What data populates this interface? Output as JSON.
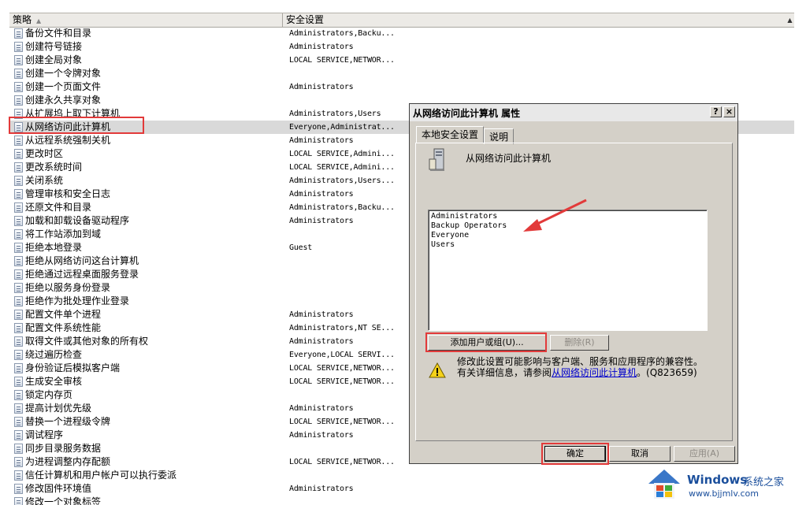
{
  "list": {
    "col_policy": "策略",
    "col_setting": "安全设置",
    "rows": [
      {
        "name": "备份文件和目录",
        "value": "Administrators,Backu..."
      },
      {
        "name": "创建符号链接",
        "value": "Administrators"
      },
      {
        "name": "创建全局对象",
        "value": "LOCAL SERVICE,NETWOR..."
      },
      {
        "name": "创建一个令牌对象",
        "value": ""
      },
      {
        "name": "创建一个页面文件",
        "value": "Administrators"
      },
      {
        "name": "创建永久共享对象",
        "value": ""
      },
      {
        "name": "从扩展坞上取下计算机",
        "value": "Administrators,Users"
      },
      {
        "name": "从网络访问此计算机",
        "value": "Everyone,Administrat..."
      },
      {
        "name": "从远程系统强制关机",
        "value": "Administrators"
      },
      {
        "name": "更改时区",
        "value": "LOCAL SERVICE,Admini..."
      },
      {
        "name": "更改系统时间",
        "value": "LOCAL SERVICE,Admini..."
      },
      {
        "name": "关闭系统",
        "value": "Administrators,Users..."
      },
      {
        "name": "管理审核和安全日志",
        "value": "Administrators"
      },
      {
        "name": "还原文件和目录",
        "value": "Administrators,Backu..."
      },
      {
        "name": "加载和卸载设备驱动程序",
        "value": "Administrators"
      },
      {
        "name": "将工作站添加到域",
        "value": ""
      },
      {
        "name": "拒绝本地登录",
        "value": "Guest"
      },
      {
        "name": "拒绝从网络访问这台计算机",
        "value": ""
      },
      {
        "name": "拒绝通过远程桌面服务登录",
        "value": ""
      },
      {
        "name": "拒绝以服务身份登录",
        "value": ""
      },
      {
        "name": "拒绝作为批处理作业登录",
        "value": ""
      },
      {
        "name": "配置文件单个进程",
        "value": "Administrators"
      },
      {
        "name": "配置文件系统性能",
        "value": "Administrators,NT SE..."
      },
      {
        "name": "取得文件或其他对象的所有权",
        "value": "Administrators"
      },
      {
        "name": "绕过遍历检查",
        "value": "Everyone,LOCAL SERVI..."
      },
      {
        "name": "身份验证后模拟客户端",
        "value": "LOCAL SERVICE,NETWOR..."
      },
      {
        "name": "生成安全审核",
        "value": "LOCAL SERVICE,NETWOR..."
      },
      {
        "name": "锁定内存页",
        "value": ""
      },
      {
        "name": "提高计划优先级",
        "value": "Administrators"
      },
      {
        "name": "替换一个进程级令牌",
        "value": "LOCAL SERVICE,NETWOR..."
      },
      {
        "name": "调试程序",
        "value": "Administrators"
      },
      {
        "name": "同步目录服务数据",
        "value": ""
      },
      {
        "name": "为进程调整内存配额",
        "value": "LOCAL SERVICE,NETWOR..."
      },
      {
        "name": "信任计算机和用户帐户可以执行委派",
        "value": ""
      },
      {
        "name": "修改固件环境值",
        "value": "Administrators"
      },
      {
        "name": "修改一个对象标签",
        "value": ""
      }
    ]
  },
  "dialog": {
    "title": "从网络访问此计算机 属性",
    "help_btn": "?",
    "close_btn": "×",
    "tabs": [
      "本地安全设置",
      "说明"
    ],
    "policy_name": "从网络访问此计算机",
    "members": [
      "Administrators",
      "Backup Operators",
      "Everyone",
      "Users"
    ],
    "add_button": "添加用户或组(U)...",
    "remove_button": "删除(R)",
    "warning_line1": "修改此设置可能影响与客户端、服务和应用程序的兼容性。",
    "warning_line2_prefix": "有关详细信息，请参阅",
    "warning_link": "从网络访问此计算机",
    "warning_kb": "。(Q823659)",
    "ok_button": "确定",
    "cancel_button": "取消",
    "apply_button": "应用(A)"
  },
  "watermark": {
    "brand": "Windows",
    "brand_suffix": "系统之家",
    "url": "www.bjjmlv.com"
  }
}
